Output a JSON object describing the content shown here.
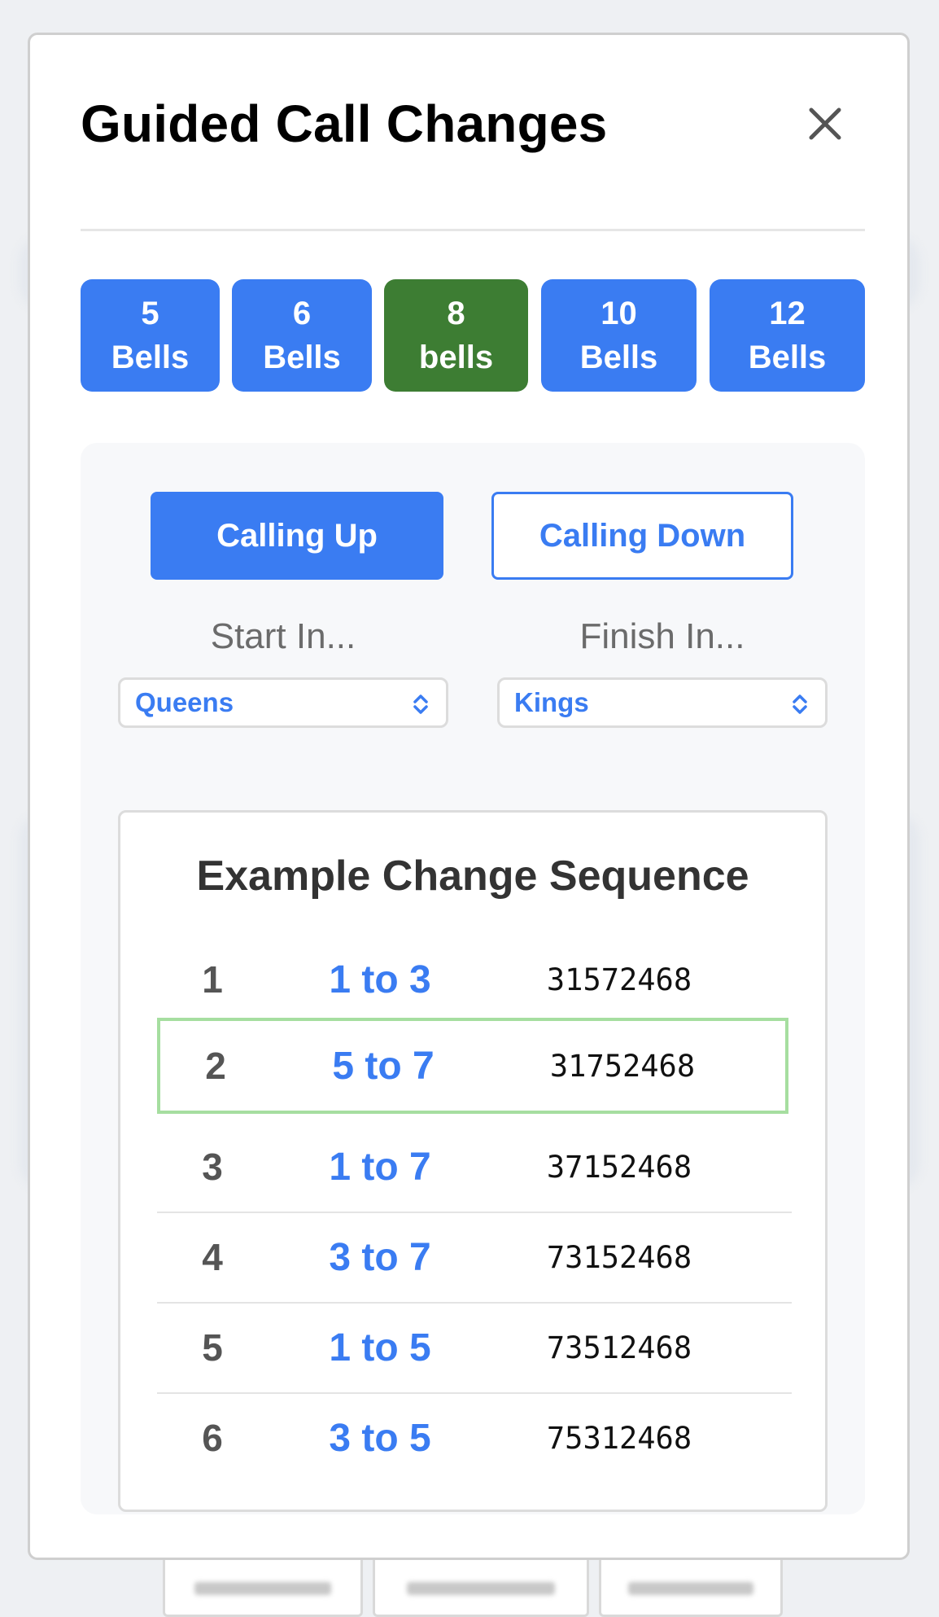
{
  "modal": {
    "title": "Guided Call Changes",
    "close_icon": "close-icon"
  },
  "bell_options": [
    {
      "number": "5",
      "word": "Bells",
      "active": false
    },
    {
      "number": "6",
      "word": "Bells",
      "active": false
    },
    {
      "number": "8",
      "word": "bells",
      "active": true
    },
    {
      "number": "10",
      "word": "Bells",
      "active": false
    },
    {
      "number": "12",
      "word": "Bells",
      "active": false
    }
  ],
  "mode": {
    "calling_up": "Calling Up",
    "calling_down": "Calling Down",
    "selected": "Calling Up"
  },
  "start": {
    "label": "Start In...",
    "value": "Queens"
  },
  "finish": {
    "label": "Finish In...",
    "value": "Kings"
  },
  "sequence": {
    "title": "Example Change Sequence",
    "rows": [
      {
        "num": "1",
        "call": "1 to 3",
        "order": "31572468"
      },
      {
        "num": "2",
        "call": "5 to 7",
        "order": "31752468",
        "current": true
      },
      {
        "num": "3",
        "call": "1 to 7",
        "order": "37152468"
      },
      {
        "num": "4",
        "call": "3 to 7",
        "order": "73152468"
      },
      {
        "num": "5",
        "call": "1 to 5",
        "order": "73512468"
      },
      {
        "num": "6",
        "call": "3 to 5",
        "order": "75312468"
      }
    ]
  },
  "colors": {
    "accent": "#3a7cf2",
    "active_bell": "#3d7d33",
    "current_row_border": "#a6dea0"
  }
}
